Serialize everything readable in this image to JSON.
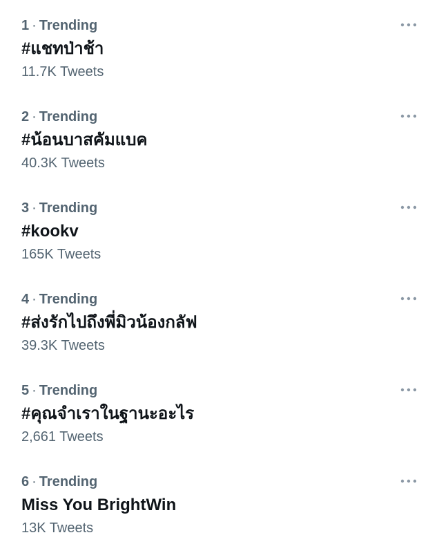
{
  "trends": [
    {
      "rank": "1",
      "separator": "·",
      "label": "Trending",
      "title": "#แชทป่าช้า",
      "count": "11.7K Tweets"
    },
    {
      "rank": "2",
      "separator": "·",
      "label": "Trending",
      "title": "#น้อนบาสคัมแบค",
      "count": "40.3K Tweets"
    },
    {
      "rank": "3",
      "separator": "·",
      "label": "Trending",
      "title": "#kookv",
      "count": "165K Tweets"
    },
    {
      "rank": "4",
      "separator": "·",
      "label": "Trending",
      "title": "#ส่งรักไปถึงพี่มิวน้องกลัฟ",
      "count": "39.3K Tweets"
    },
    {
      "rank": "5",
      "separator": "·",
      "label": "Trending",
      "title": "#คุณจำเราในฐานะอะไร",
      "count": "2,661 Tweets"
    },
    {
      "rank": "6",
      "separator": "·",
      "label": "Trending",
      "title": "Miss You BrightWin",
      "count": "13K Tweets"
    }
  ],
  "more_icon": "more-horizontal-icon",
  "colors": {
    "primary_text": "#0f1419",
    "secondary_text": "#536471",
    "icon": "#8b98a5",
    "background": "#ffffff"
  }
}
